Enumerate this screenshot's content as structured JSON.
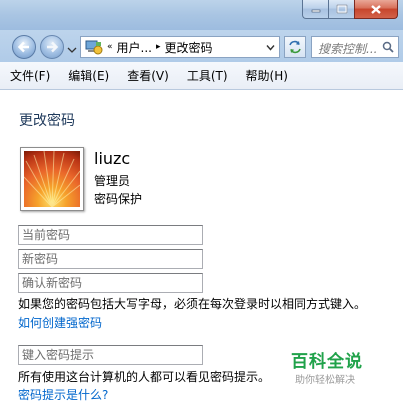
{
  "window": {
    "caption_buttons": [
      "minimize",
      "maximize",
      "close"
    ]
  },
  "navigation": {
    "address_crumbs": [
      "«",
      "用户...",
      "▸",
      "更改密码"
    ],
    "search_placeholder": "搜索控制..."
  },
  "menu": {
    "items": [
      "文件(F)",
      "编辑(E)",
      "查看(V)",
      "工具(T)",
      "帮助(H)"
    ]
  },
  "content": {
    "title": "更改密码",
    "user": {
      "name": "liuzc",
      "role": "管理员",
      "status": "密码保护"
    },
    "fields": {
      "current_password_placeholder": "当前密码",
      "new_password_placeholder": "新密码",
      "confirm_password_placeholder": "确认新密码",
      "hint_placeholder": "键入密码提示"
    },
    "case_note": "如果您的密码包括大写字母，必须在每次登录时以相同方式键入。",
    "strong_password_link": "如何创建强密码",
    "hint_note": "所有使用这台计算机的人都可以看见密码提示。",
    "hint_link": "密码提示是什么?"
  },
  "watermark": {
    "title": "百科全说",
    "subtitle": "助你轻松解决"
  },
  "colors": {
    "link": "#0066cc",
    "title": "#1e395b",
    "watermark": "#20a24a"
  }
}
